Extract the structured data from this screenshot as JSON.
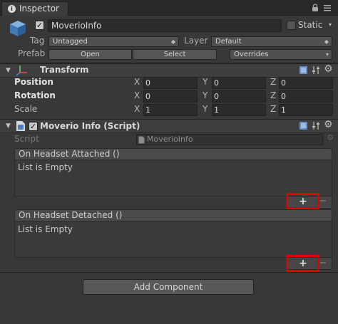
{
  "window": {
    "tab_title": "Inspector"
  },
  "header": {
    "active": true,
    "object_name": "MoverioInfo",
    "static_label": "Static",
    "static_checked": false,
    "tag_label": "Tag",
    "tag_value": "Untagged",
    "layer_label": "Layer",
    "layer_value": "Default",
    "prefab_label": "Prefab",
    "open_label": "Open",
    "select_label": "Select",
    "overrides_label": "Overrides"
  },
  "transform": {
    "title": "Transform",
    "position": {
      "label": "Position",
      "x": "0",
      "y": "0",
      "z": "0"
    },
    "rotation": {
      "label": "Rotation",
      "x": "0",
      "y": "0",
      "z": "0"
    },
    "scale": {
      "label": "Scale",
      "x": "1",
      "y": "1",
      "z": "1"
    },
    "axis_x": "X",
    "axis_y": "Y",
    "axis_z": "Z"
  },
  "script_component": {
    "title": "Moverio Info (Script)",
    "script_label": "Script",
    "script_value": "MoverioInfo",
    "events": [
      {
        "header": "On Headset Attached ()",
        "empty_text": "List is Empty",
        "plus": "+",
        "minus": "−"
      },
      {
        "header": "On Headset Detached ()",
        "empty_text": "List is Empty",
        "plus": "+",
        "minus": "−"
      }
    ]
  },
  "footer": {
    "add_component_label": "Add Component"
  },
  "colors": {
    "background": "#383838",
    "highlight": "#e00000"
  },
  "icons": [
    "info-icon",
    "lock-icon",
    "menu-icon",
    "gameobject-cube-icon",
    "transform-axes-icon",
    "script-file-icon",
    "book-help-icon",
    "preset-sliders-icon",
    "gear-icon"
  ]
}
